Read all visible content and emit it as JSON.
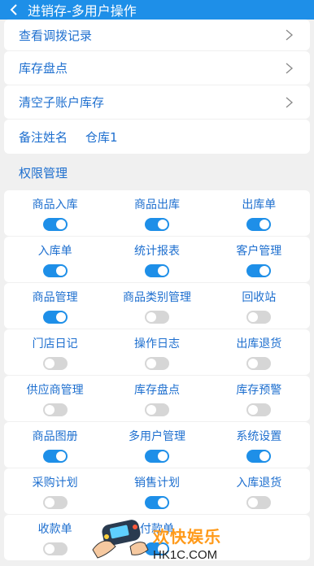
{
  "header": {
    "title": "进销存-多用户操作"
  },
  "menu": [
    {
      "label": "查看调拨记录"
    },
    {
      "label": "库存盘点"
    },
    {
      "label": "清空子账户库存"
    }
  ],
  "note": {
    "label": "备注姓名",
    "value": "仓库1"
  },
  "permissions": {
    "heading": "权限管理",
    "rows": [
      [
        {
          "label": "商品入库",
          "enabled": true
        },
        {
          "label": "商品出库",
          "enabled": true
        },
        {
          "label": "出库单",
          "enabled": true
        }
      ],
      [
        {
          "label": "入库单",
          "enabled": true
        },
        {
          "label": "统计报表",
          "enabled": true
        },
        {
          "label": "客户管理",
          "enabled": true
        }
      ],
      [
        {
          "label": "商品管理",
          "enabled": true
        },
        {
          "label": "商品类别管理",
          "enabled": false
        },
        {
          "label": "回收站",
          "enabled": false
        }
      ],
      [
        {
          "label": "门店日记",
          "enabled": false
        },
        {
          "label": "操作日志",
          "enabled": false
        },
        {
          "label": "出库退货",
          "enabled": false
        }
      ],
      [
        {
          "label": "供应商管理",
          "enabled": false
        },
        {
          "label": "库存盘点",
          "enabled": false
        },
        {
          "label": "库存预警",
          "enabled": false
        }
      ],
      [
        {
          "label": "商品图册",
          "enabled": true
        },
        {
          "label": "多用户管理",
          "enabled": true
        },
        {
          "label": "系统设置",
          "enabled": true
        }
      ],
      [
        {
          "label": "采购计划",
          "enabled": false
        },
        {
          "label": "销售计划",
          "enabled": true
        },
        {
          "label": "入库退货",
          "enabled": false
        }
      ],
      [
        {
          "label": "收款单",
          "enabled": false
        },
        {
          "label": "付款单",
          "enabled": true
        }
      ]
    ]
  },
  "watermark": {
    "title": "欢快娱乐",
    "url": "HK1C.COM"
  },
  "colors": {
    "accent": "#1e8fe8",
    "text": "#1e6fcf",
    "toggle_off": "#d6d6d6"
  }
}
